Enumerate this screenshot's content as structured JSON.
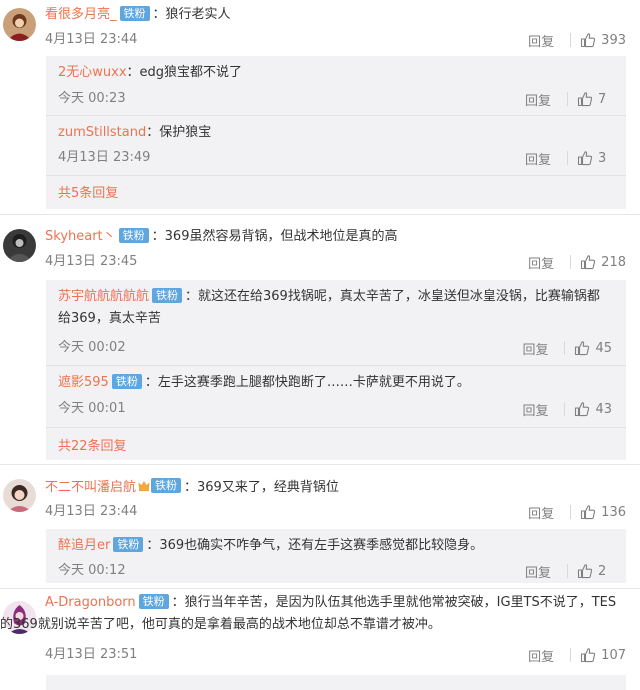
{
  "ui": {
    "reply_label": "回复"
  },
  "comments": [
    {
      "user": "看很多月亮_",
      "badge": "铁粉",
      "text": "：狼行老实人",
      "time": "4月13日 23:44",
      "likes": "393",
      "replies": [
        {
          "user": "2无心wuxx",
          "text": "：edg狼宝都不说了",
          "time": "今天 00:23",
          "likes": "7"
        },
        {
          "user": "zumStillstand",
          "text": "：保护狼宝",
          "time": "4月13日 23:49",
          "likes": "3"
        }
      ],
      "more": "共5条回复"
    },
    {
      "user": "Skyheart丶",
      "badge": "铁粉",
      "text": "：369虽然容易背锅，但战术地位是真的高",
      "time": "4月13日 23:45",
      "likes": "218",
      "replies": [
        {
          "user": "苏宇航航航航航",
          "badge": "铁粉",
          "text_line1": "：就这还在给369找锅呢，真太辛苦了，冰皇送但冰皇没锅，比赛输锅都",
          "text_line2": "给369，真太辛苦",
          "time": "今天 00:02",
          "likes": "45"
        },
        {
          "user": "遮影595",
          "badge": "铁粉",
          "text": "：左手这赛季跑上腿都快跑断了……卡萨就更不用说了。",
          "time": "今天 00:01",
          "likes": "43"
        }
      ],
      "more": "共22条回复"
    },
    {
      "user": "不二不叫潘启航",
      "badge": "铁粉",
      "text": "：369又来了，经典背锅位",
      "time": "4月13日 23:44",
      "likes": "136",
      "replies": [
        {
          "user": "醉追月er",
          "badge": "铁粉",
          "text": "：369也确实不咋争气，还有左手这赛季感觉都比较隐身。",
          "time": "今天 00:12",
          "likes": "2"
        }
      ]
    },
    {
      "user": "A-Dragonborn",
      "badge": "铁粉",
      "text_line1": "：狼行当年辛苦，是因为队伍其他选手里就他常被突破，IG里TS不说了，TES",
      "text_line2": "的369就别说辛苦了吧，他可真的是拿着最高的战术地位却总不靠谱才被冲。",
      "time": "4月13日 23:51",
      "likes": "107"
    }
  ],
  "colors": {
    "username": "#eb7350",
    "badge": "#5ea6dd",
    "meta": "#808080",
    "sub_bg": "#f2f2f5"
  }
}
